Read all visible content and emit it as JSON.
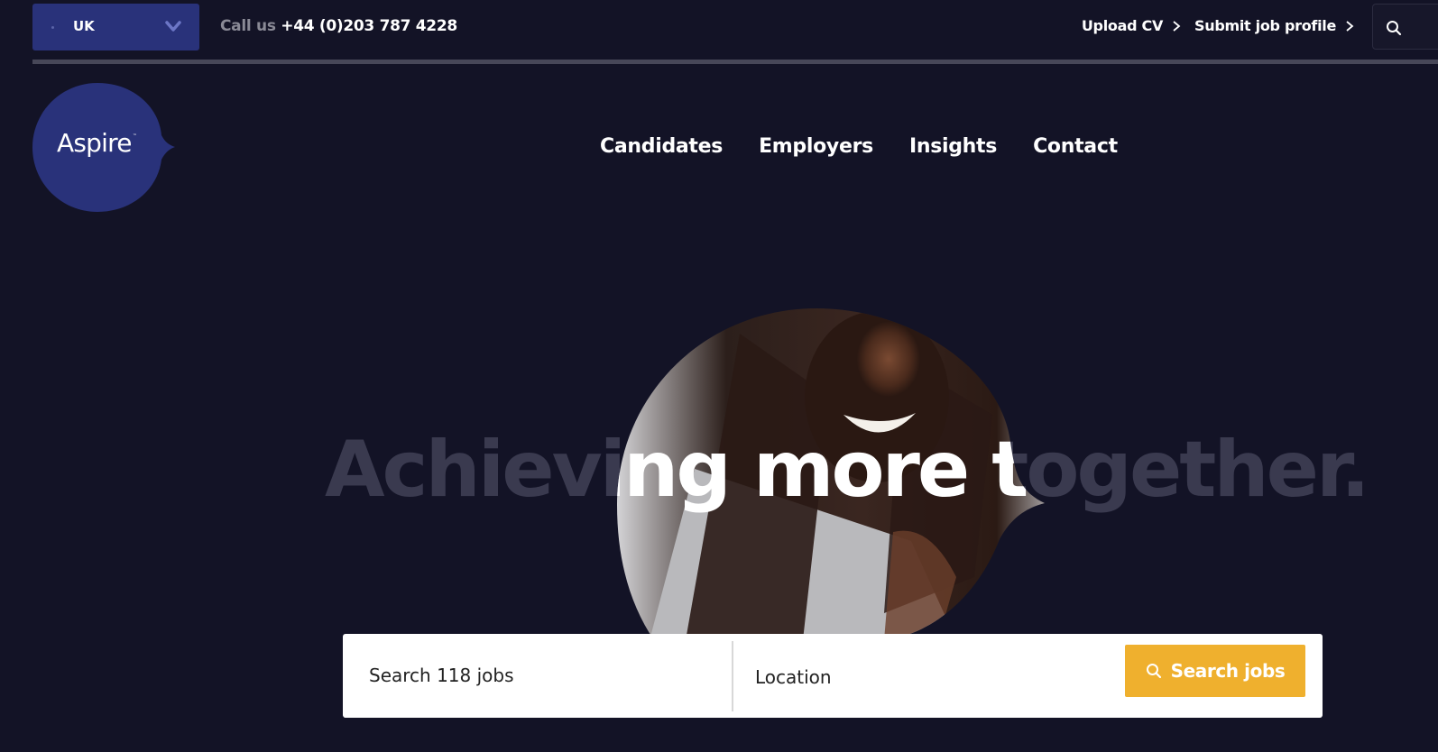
{
  "topbar": {
    "country": "UK",
    "call_prefix": "Call us",
    "phone": "+44 (0)203 787 4228",
    "links": [
      {
        "label": "Upload CV",
        "icon": "chevron-right-icon"
      },
      {
        "label": "Submit job profile",
        "icon": "chevron-right-icon"
      }
    ],
    "search_icon": "search-icon"
  },
  "logo": {
    "text": "Aspire",
    "tm": "™"
  },
  "nav": [
    "Candidates",
    "Employers",
    "Insights",
    "Contact"
  ],
  "hero": {
    "headline": "Achieving more together.",
    "image": "smiling-woman-photo"
  },
  "search": {
    "keyword_placeholder": "Search 118 jobs",
    "location_placeholder": "Location",
    "button_label": "Search jobs"
  },
  "colors": {
    "background": "#131326",
    "brand_blue": "#29327a",
    "accent_yellow": "#efb02e"
  }
}
